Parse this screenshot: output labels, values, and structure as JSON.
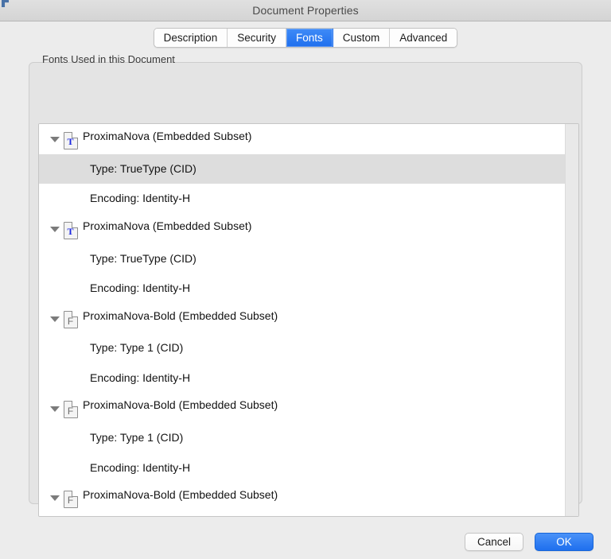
{
  "window": {
    "title": "Document Properties"
  },
  "tabs": [
    {
      "label": "Description",
      "selected": false
    },
    {
      "label": "Security",
      "selected": false
    },
    {
      "label": "Fonts",
      "selected": true
    },
    {
      "label": "Custom",
      "selected": false
    },
    {
      "label": "Advanced",
      "selected": false
    }
  ],
  "panel": {
    "group_label": "Fonts Used in this Document"
  },
  "font_list": [
    {
      "kind": "parent",
      "icon": "truetype-font-icon",
      "glyph": "T",
      "label": "ProximaNova (Embedded Subset)",
      "selected": false
    },
    {
      "kind": "child",
      "label": "Type: TrueType (CID)",
      "selected": true
    },
    {
      "kind": "child",
      "label": "Encoding: Identity-H",
      "selected": false
    },
    {
      "kind": "parent",
      "icon": "truetype-font-icon",
      "glyph": "T",
      "label": "ProximaNova (Embedded Subset)",
      "selected": false
    },
    {
      "kind": "child",
      "label": "Type: TrueType (CID)",
      "selected": false
    },
    {
      "kind": "child",
      "label": "Encoding: Identity-H",
      "selected": false
    },
    {
      "kind": "parent",
      "icon": "type1-font-icon",
      "glyph": "F",
      "label": "ProximaNova-Bold (Embedded Subset)",
      "selected": false
    },
    {
      "kind": "child",
      "label": "Type: Type 1 (CID)",
      "selected": false
    },
    {
      "kind": "child",
      "label": "Encoding: Identity-H",
      "selected": false
    },
    {
      "kind": "parent",
      "icon": "type1-font-icon",
      "glyph": "F",
      "label": "ProximaNova-Bold (Embedded Subset)",
      "selected": false
    },
    {
      "kind": "child",
      "label": "Type: Type 1 (CID)",
      "selected": false
    },
    {
      "kind": "child",
      "label": "Encoding: Identity-H",
      "selected": false
    },
    {
      "kind": "parent",
      "icon": "type1-font-icon",
      "glyph": "F",
      "label": "ProximaNova-Bold (Embedded Subset)",
      "selected": false
    }
  ],
  "buttons": {
    "cancel_label": "Cancel",
    "ok_label": "OK"
  },
  "colors": {
    "accent_blue": "#1f6fee",
    "selected_row": "#dddddd",
    "window_bg": "#ececec",
    "list_bg": "#ffffff"
  }
}
